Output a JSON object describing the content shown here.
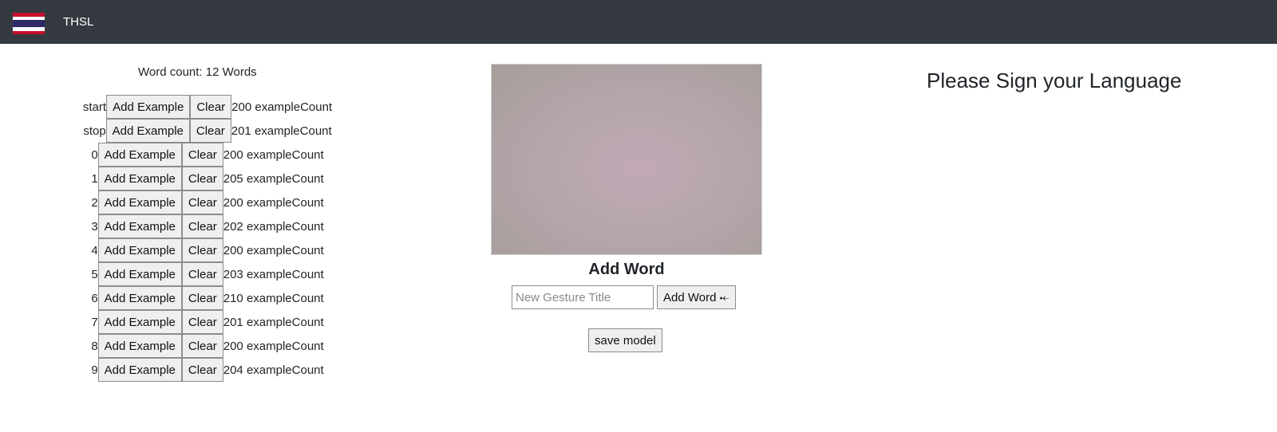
{
  "navbar": {
    "brand": "THSL",
    "flag_icon": "thai-flag-icon"
  },
  "word_count": "Word count: 12 Words",
  "rows": [
    {
      "label": "start",
      "add_label": "Add Example",
      "clear_label": "Clear",
      "count": "200 exampleCount"
    },
    {
      "label": "stop",
      "add_label": "Add Example",
      "clear_label": "Clear",
      "count": "201 exampleCount"
    },
    {
      "label": "0",
      "add_label": "Add Example",
      "clear_label": "Clear",
      "count": "200 exampleCount"
    },
    {
      "label": "1",
      "add_label": "Add Example",
      "clear_label": "Clear",
      "count": "205 exampleCount"
    },
    {
      "label": "2",
      "add_label": "Add Example",
      "clear_label": "Clear",
      "count": "200 exampleCount"
    },
    {
      "label": "3",
      "add_label": "Add Example",
      "clear_label": "Clear",
      "count": "202 exampleCount"
    },
    {
      "label": "4",
      "add_label": "Add Example",
      "clear_label": "Clear",
      "count": "200 exampleCount"
    },
    {
      "label": "5",
      "add_label": "Add Example",
      "clear_label": "Clear",
      "count": "203 exampleCount"
    },
    {
      "label": "6",
      "add_label": "Add Example",
      "clear_label": "Clear",
      "count": "210 exampleCount"
    },
    {
      "label": "7",
      "add_label": "Add Example",
      "clear_label": "Clear",
      "count": "201 exampleCount"
    },
    {
      "label": "8",
      "add_label": "Add Example",
      "clear_label": "Clear",
      "count": "200 exampleCount"
    },
    {
      "label": "9",
      "add_label": "Add Example",
      "clear_label": "Clear",
      "count": "204 exampleCount"
    }
  ],
  "add_word": {
    "title": "Add Word",
    "input_placeholder": "New Gesture Title",
    "input_value": "",
    "button_label": "Add Word ⤝"
  },
  "save_model_label": "save model",
  "prompt": "Please Sign your Language",
  "colors": {
    "navbar": "#343a40",
    "button_bg": "#efefef",
    "button_border": "#8c8c8c"
  }
}
